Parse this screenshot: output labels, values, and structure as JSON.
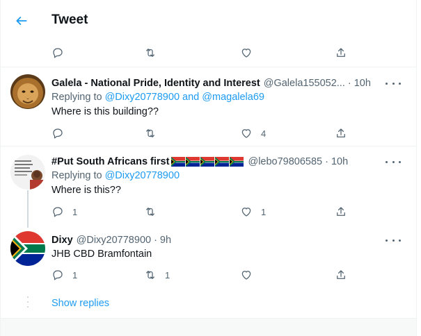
{
  "header": {
    "title": "Tweet"
  },
  "top_actions": {
    "reply_count": "",
    "retweet_count": "",
    "like_count": ""
  },
  "tweets": [
    {
      "name": "Galela - National Pride, Identity and Interest",
      "handle": "@Galela155052...",
      "sep": "·",
      "time": "10h",
      "replying_prefix": "Replying to",
      "replying_user1": "@Dixy20778900",
      "replying_and": "and",
      "replying_user2": "@magalela69",
      "text": "Where is this building??",
      "reply_count": "",
      "retweet_count": "",
      "like_count": "4"
    },
    {
      "name": "#Put South Africans first",
      "flag_count": 5,
      "handle": "@lebo79806585",
      "sep": "·",
      "time": "10h",
      "replying_prefix": "Replying to",
      "replying_user1": "@Dixy20778900",
      "text": "Where is this??",
      "reply_count": "1",
      "retweet_count": "",
      "like_count": "1"
    },
    {
      "name": "Dixy",
      "handle": "@Dixy20778900",
      "sep": "·",
      "time": "9h",
      "text": "JHB CBD Bramfontain",
      "reply_count": "1",
      "retweet_count": "1",
      "like_count": ""
    }
  ],
  "show_replies": "Show replies",
  "colors": {
    "accent": "#1d9bf0",
    "muted": "#536471",
    "border": "#eff3f4"
  },
  "icons": [
    "back-arrow-icon",
    "reply-icon",
    "retweet-icon",
    "like-icon",
    "share-icon",
    "more-icon",
    "south-africa-flag-icon"
  ]
}
